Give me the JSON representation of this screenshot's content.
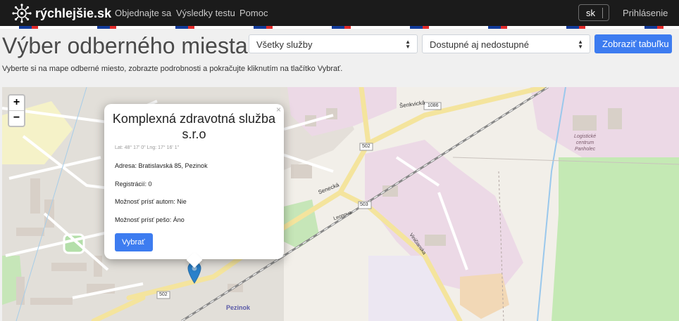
{
  "navbar": {
    "brand": "rýchlejšie.sk",
    "links": [
      "Objednajte sa",
      "Výsledky testu",
      "Pomoc"
    ],
    "language": "sk",
    "login": "Prihlásenie"
  },
  "header": {
    "title": "Výber odberného miesta",
    "service_select": "Všetky služby",
    "availability_select": "Dostupné aj nedostupné",
    "table_button": "Zobraziť tabuľku",
    "subtitle": "Vyberte si na mape odberné miesto, zobrazte podrobnosti a pokračujte kliknutím na tlačítko Vybrať."
  },
  "map": {
    "zoom_in": "+",
    "zoom_out": "−",
    "labels": {
      "road_1086": "1086",
      "road_502_a": "502",
      "road_503": "503",
      "road_502_b": "502",
      "senecka": "Senecká",
      "senicka": "Šenkvická",
      "leonova": "Leonova",
      "vinicianska": "Viničianska",
      "city": "Pezinok",
      "logistic_1": "Logistické",
      "logistic_2": "centrum",
      "logistic_3": "Panholec"
    }
  },
  "popup": {
    "close": "×",
    "title": "Komplexná zdravotná služba s.r.o",
    "coords": "Lat: 48° 17' 0\" Lng: 17° 16' 1\"",
    "address": "Adresa: Bratislavská 85, Pezinok",
    "registrations": "Registrácií: 0",
    "car": "Možnosť prísť autom: Nie",
    "walk": "Možnosť prísť pešo: Áno",
    "select_button": "Vybrať"
  },
  "colors": {
    "primary": "#3d7cf0",
    "navbar": "#1b1b1b",
    "marker": "#2a81cb"
  }
}
